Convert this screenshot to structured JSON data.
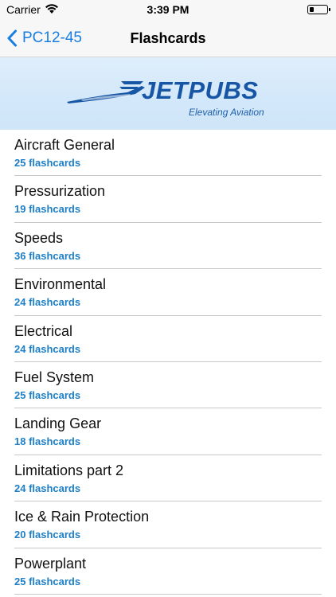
{
  "status_bar": {
    "carrier": "Carrier",
    "time": "3:39 PM",
    "battery_level": 0.25
  },
  "nav": {
    "back_label": "PC12-45",
    "title": "Flashcards"
  },
  "banner": {
    "brand": "JETPUBS",
    "tagline": "Elevating Aviation"
  },
  "colors": {
    "accent": "#1a7ee0",
    "count_text": "#1e7fc6",
    "brand_blue": "#1755a5"
  },
  "decks": [
    {
      "title": "Aircraft General",
      "count": "25 flashcards"
    },
    {
      "title": "Pressurization",
      "count": "19 flashcards"
    },
    {
      "title": "Speeds",
      "count": "36 flashcards"
    },
    {
      "title": "Environmental",
      "count": "24 flashcards"
    },
    {
      "title": "Electrical",
      "count": "24 flashcards"
    },
    {
      "title": "Fuel System",
      "count": "25 flashcards"
    },
    {
      "title": "Landing Gear",
      "count": "18 flashcards"
    },
    {
      "title": "Limitations part 2",
      "count": "24 flashcards"
    },
    {
      "title": "Ice & Rain Protection",
      "count": "20 flashcards"
    },
    {
      "title": "Powerplant",
      "count": "25 flashcards"
    }
  ]
}
